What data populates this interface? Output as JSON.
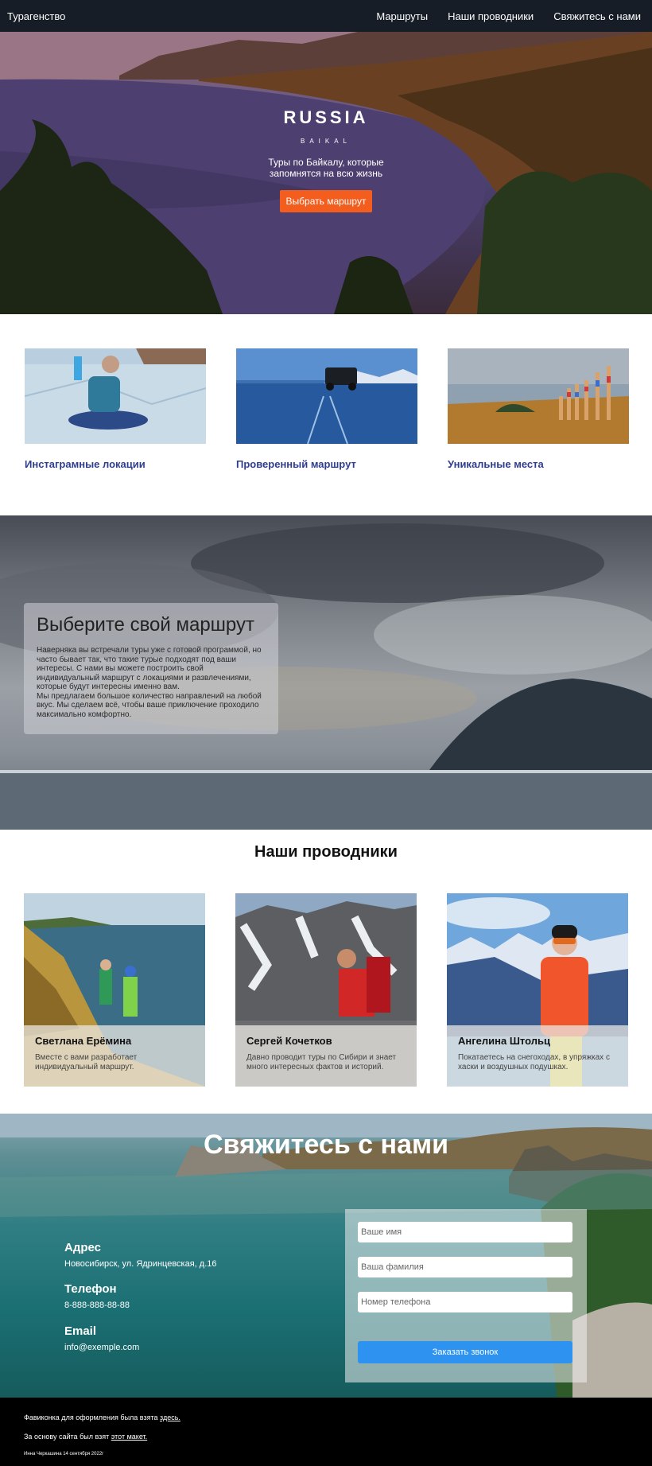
{
  "nav": {
    "brand": "Турагенство",
    "links": [
      "Маршруты",
      "Наши проводники",
      "Свяжитесь с нами"
    ]
  },
  "hero": {
    "title": "RUSSIA",
    "subtitle": "BAIKAL",
    "tagline": "Туры по Байкалу, которые запомнятся на всю жизнь",
    "button": "Выбрать маршрут"
  },
  "features": [
    {
      "caption": "Инстаграмные локации"
    },
    {
      "caption": "Проверенный маршрут"
    },
    {
      "caption": "Уникальные места"
    }
  ],
  "route": {
    "title": "Выберите свой маршрут",
    "paragraph1": "Наверняка вы встречали туры уже с готовой программой, но часто бывает так, что такие турые подходят под ваши интересы. С нами вы можете построить свой индивидуальный маршрут с локациями и развлечениями, которые будут интересны именно вам.",
    "paragraph2": "Мы предлагаем большое количество направлений на любой вкус. Мы сделаем всё, чтобы ваше приключение проходило максимально комфортно."
  },
  "guides": {
    "title": "Наши проводники",
    "items": [
      {
        "name": "Светлана Ерёмина",
        "desc": "Вместе с вами разработает индивидуальный маршрут."
      },
      {
        "name": "Сергей Кочетков",
        "desc": "Давно проводит туры по Сибири и знает много интересных фактов и историй."
      },
      {
        "name": "Ангелина Штольц",
        "desc": "Покатаетесь на снегоходах, в упряжках с хаски и воздушных подушках."
      }
    ]
  },
  "contact": {
    "title": "Свяжитесь с нами",
    "address_label": "Адрес",
    "address_value": "Новосибирск, ул. Ядринцевская, д.16",
    "phone_label": "Телефон",
    "phone_value": "8-888-888-88-88",
    "email_label": "Email",
    "email_value": "info@exemple.com",
    "form": {
      "name_placeholder": "Ваше имя",
      "surname_placeholder": "Ваша фамилия",
      "phone_placeholder": "Номер телефона",
      "submit": "Заказать звонок"
    }
  },
  "footer": {
    "favicon_text": "Фавиконка для оформления была взята ",
    "favicon_link": "здесь.",
    "base_text": "За основу сайта был взят ",
    "base_link": "этот макет.",
    "credit": "Инна Черкашина 14 сентября 2022г"
  }
}
